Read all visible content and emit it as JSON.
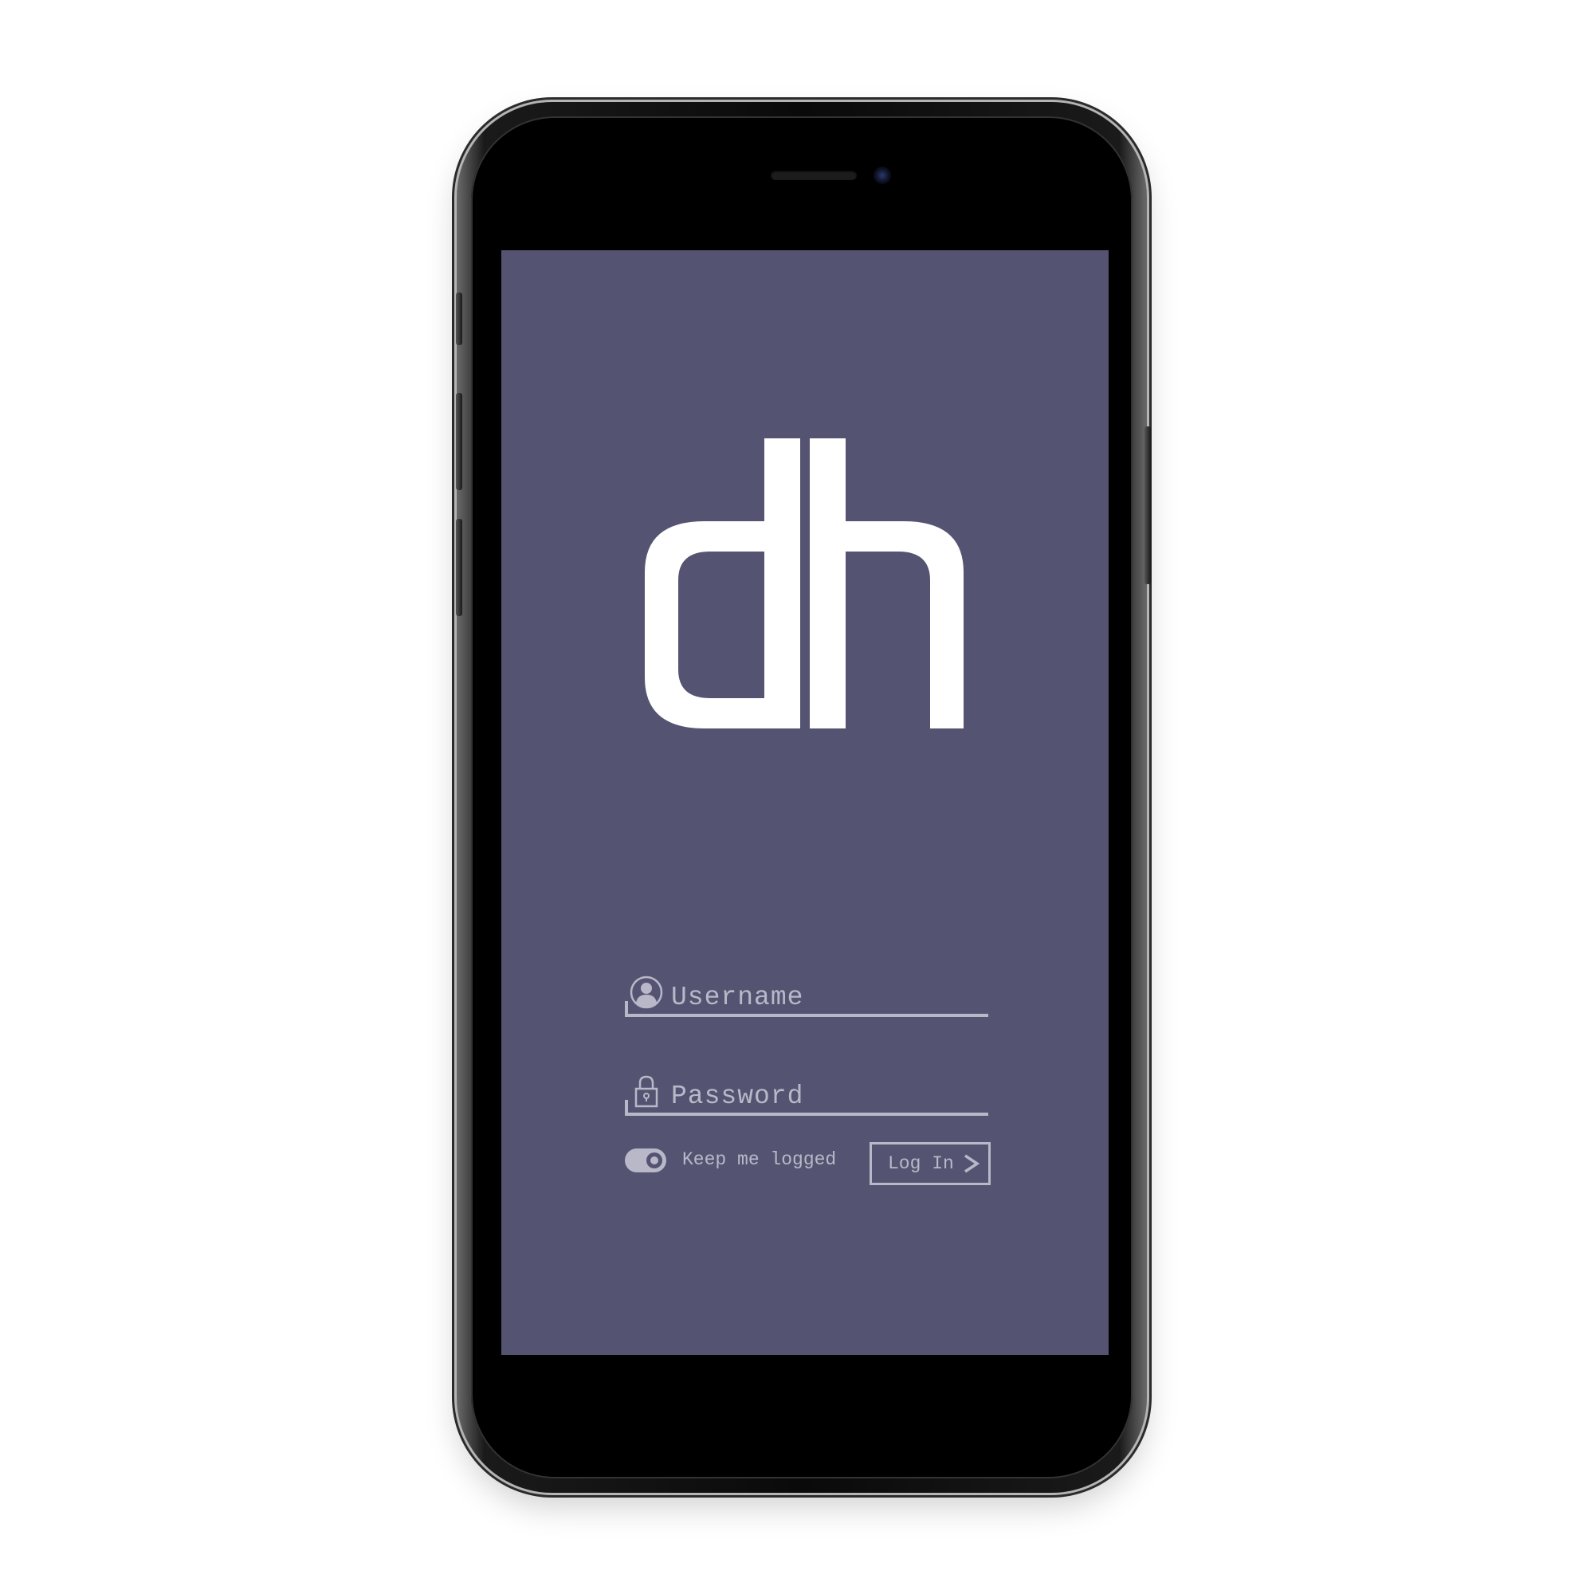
{
  "app": {
    "logo_text": "dh"
  },
  "login": {
    "username_placeholder": "Username",
    "password_placeholder": "Password",
    "keep_logged_label": "Keep me logged",
    "keep_logged_on": true,
    "login_button_label": "Log In"
  },
  "theme": {
    "screen_background": "#545472",
    "foreground": "#b9b8c8",
    "logo_color": "#ffffff",
    "device_frame": "#000000"
  },
  "icons": {
    "username": "user-circle-icon",
    "password": "padlock-icon",
    "login_arrow": "chevron-right-icon"
  }
}
